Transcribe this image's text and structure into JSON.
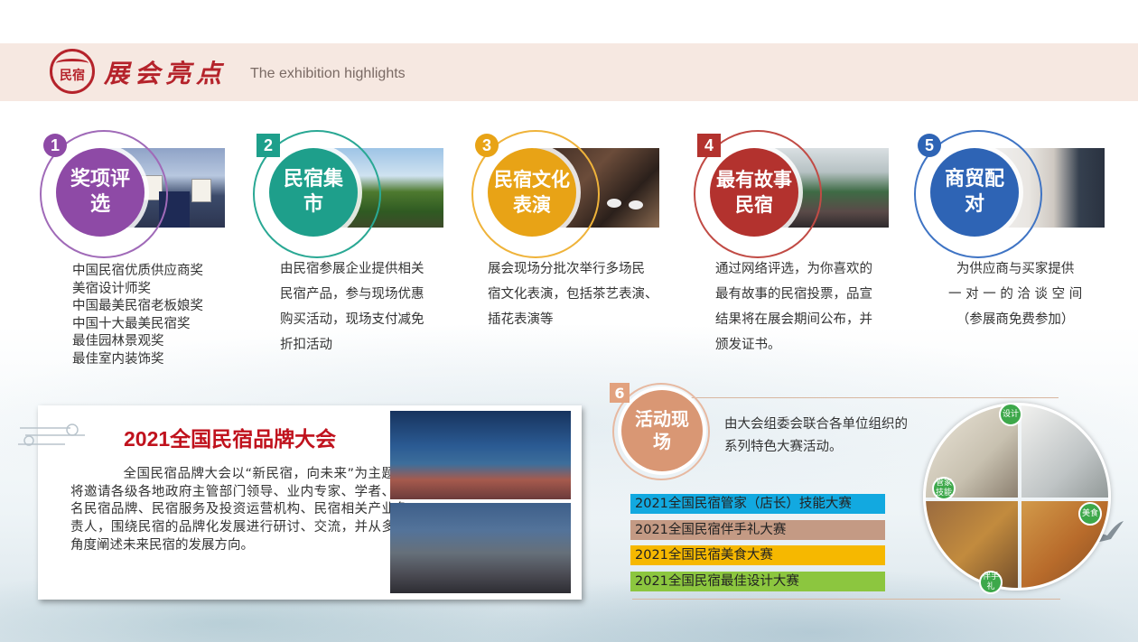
{
  "header": {
    "logo_glyph": "民宿",
    "title": "展会亮点",
    "subtitle": "The exhibition highlights"
  },
  "features": [
    {
      "number": "1",
      "bubble": "奖项评选",
      "color": "#8e4aa6",
      "items": [
        "中国民宿优质供应商奖",
        "美宿设计师奖",
        "中国最美民宿老板娘奖",
        "中国十大最美民宿奖",
        "最佳园林景观奖",
        "最佳室内装饰奖"
      ]
    },
    {
      "number": "2",
      "bubble": "民宿集市",
      "color": "#1e9f8b",
      "lines": [
        "由民宿参展企业提供相关",
        "民宿产品，参与现场优惠",
        "购买活动，现场支付减免",
        "折扣活动"
      ]
    },
    {
      "number": "3",
      "bubble": "民宿文化表演",
      "color": "#e8a316",
      "lines": [
        "展会现场分批次举行多场民",
        "宿文化表演，包括茶艺表演、",
        "插花表演等"
      ]
    },
    {
      "number": "4",
      "bubble": "最有故事民宿",
      "color": "#b3322e",
      "lines": [
        "通过网络评选，为你喜欢的",
        "最有故事的民宿投票，品宣",
        "结果将在展会期间公布，并",
        "颁发证书。"
      ]
    },
    {
      "number": "5",
      "bubble": "商贸配对",
      "color": "#2e64b5",
      "lines": [
        "为供应商与买家提供",
        "一 对 一 的 洽 谈 空 间",
        "（参展商免费参加）"
      ]
    }
  ],
  "conference": {
    "title": "2021全国民宿品牌大会",
    "text": "全国民宿品牌大会以“新民宿，向未来”为主题，将邀请各级各地政府主管部门领导、业内专家、学者、知名民宿品牌、民宿服务及投资运营机构、民宿相关产业负责人，围绕民宿的品牌化发展进行研讨、交流，并从多个角度阐述未来民宿的发展方向。"
  },
  "activities": {
    "number": "6",
    "bubble": "活动现场",
    "color": "#d99774",
    "desc_lines": [
      "由大会组委会联合各单位组织的",
      "系列特色大赛活动。"
    ],
    "contests": [
      {
        "label": "2021全国民宿管家（店长）技能大赛",
        "color": "#12a9e0"
      },
      {
        "label": "2021全国民宿伴手礼大赛",
        "color": "#c49a84"
      },
      {
        "label": "2021全国民宿美食大赛",
        "color": "#f6b800"
      },
      {
        "label": "2021全国民宿最佳设计大赛",
        "color": "#8cc63f"
      }
    ],
    "pie_tags": {
      "design": "设计",
      "butler": "管家技能",
      "food": "美食",
      "gift": "伴手礼"
    }
  }
}
